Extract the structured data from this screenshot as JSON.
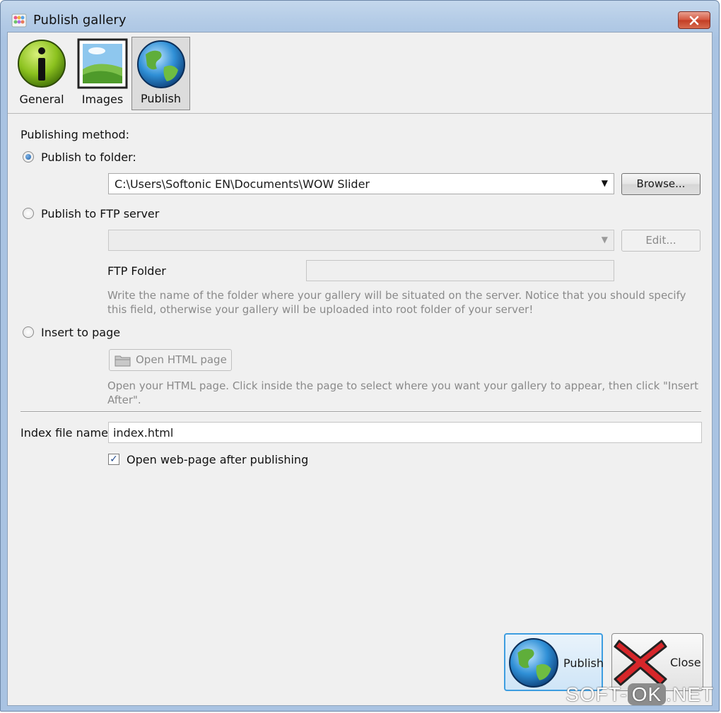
{
  "window": {
    "title": "Publish gallery"
  },
  "tabs": [
    {
      "label": "General",
      "icon": "info-icon"
    },
    {
      "label": "Images",
      "icon": "landscape-image-icon"
    },
    {
      "label": "Publish",
      "icon": "globe-icon",
      "active": true
    }
  ],
  "publishing": {
    "method_label": "Publishing method:",
    "folder": {
      "label": "Publish to folder:",
      "selected": true,
      "path": "C:\\Users\\Softonic EN\\Documents\\WOW Slider",
      "browse_label": "Browse..."
    },
    "ftp": {
      "label": "Publish to FTP server",
      "selected": false,
      "server_value": "",
      "edit_label": "Edit...",
      "folder_label": "FTP Folder",
      "folder_value": "",
      "note": "Write the name of the folder where your gallery will be situated on the server. Notice that you should specify this field, otherwise your gallery will be uploaded into root folder of your server!"
    },
    "insert": {
      "label": "Insert to page",
      "selected": false,
      "open_html_label": "Open HTML page",
      "note": "Open your HTML page. Click inside the page to select where you want your gallery to appear, then click \"Insert After\"."
    }
  },
  "index": {
    "label": "Index file name",
    "value": "index.html"
  },
  "open_after": {
    "label": "Open web-page after publishing",
    "checked": true
  },
  "actions": {
    "publish_label": "Publish",
    "close_label": "Close"
  },
  "watermark": {
    "prefix": "SOFT-",
    "middle": "OK",
    "suffix": ".NET"
  },
  "colors": {
    "title_bar": "#b3cbe6",
    "client_bg": "#f0f0f0",
    "close_red": "#c23c24"
  }
}
